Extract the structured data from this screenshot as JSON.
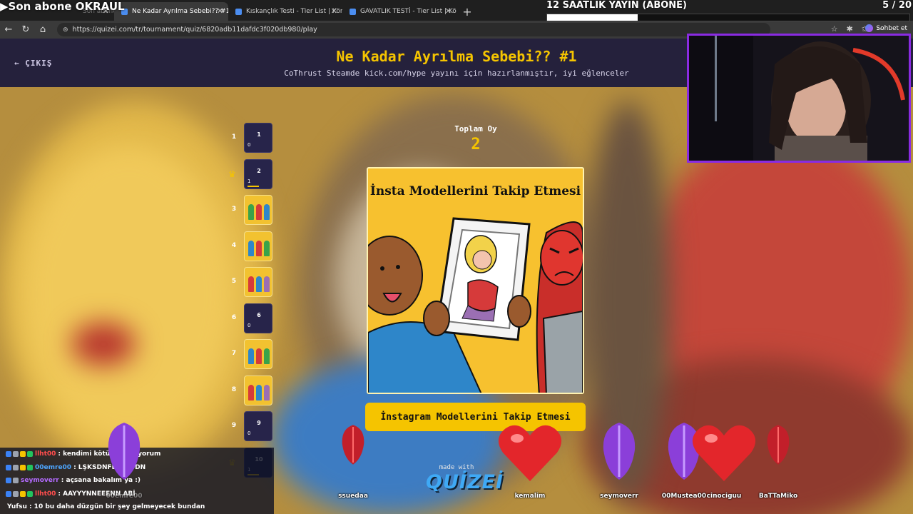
{
  "browser": {
    "tabs": [
      {
        "title": "Son abone OKRAUL",
        "active": false
      },
      {
        "title": "Ne Kadar Ayrılma Sebebi?? #1 - Ti",
        "active": true
      },
      {
        "title": "Kıskançlık Testi - Tier List | Kör Sır",
        "active": false
      },
      {
        "title": "GAVATLIK TESTİ - Tier List | Kör Sır",
        "active": false
      }
    ],
    "url": "https://quizei.com/tr/tournament/quiz/6820adb11dafdc3f020db980/play",
    "chat_button": "Sohbet et"
  },
  "stream": {
    "last_sub": "Son abone OKRAUL",
    "goal_title": "12 SAATLIK YAYIN (ABONE)",
    "goal_count": "5 / 20",
    "goal_progress": 0.25
  },
  "quiz": {
    "exit_label": "ÇIKIŞ",
    "title": "Ne Kadar Ayrılma Sebebi?? #1",
    "subtitle": "CoThrust Steamde kick.com/hype yayını için hazırlanmıştır, iyi eğlenceler",
    "total_label": "Toplam Oy",
    "total_value": "2",
    "card_title": "İnsta Modellerini Takip Etmesi",
    "answer_label": "İnstagram Modellerini Takip Etmesi",
    "made_with": "made with",
    "logo": "QUİZEİ",
    "ranks": [
      {
        "num": "1",
        "type": "empty",
        "card_num": "1",
        "votes": "0",
        "crown": false
      },
      {
        "num": "2",
        "type": "empty",
        "card_num": "2",
        "votes": "1",
        "crown": true
      },
      {
        "num": "3",
        "type": "image",
        "crown": false
      },
      {
        "num": "4",
        "type": "image",
        "crown": false
      },
      {
        "num": "5",
        "type": "image",
        "crown": false
      },
      {
        "num": "6",
        "type": "empty",
        "card_num": "6",
        "votes": "0",
        "crown": false
      },
      {
        "num": "7",
        "type": "image",
        "crown": false
      },
      {
        "num": "8",
        "type": "image",
        "crown": false
      },
      {
        "num": "9",
        "type": "empty",
        "card_num": "9",
        "votes": "0",
        "crown": false
      },
      {
        "num": "10",
        "type": "empty",
        "card_num": "10",
        "votes": "1",
        "crown": true
      }
    ]
  },
  "chat": [
    {
      "user": "llht00",
      "text": ": kendimi kötü hissediyorum",
      "color": "#ff4d4d"
    },
    {
      "user": "00emre00",
      "text": ": LŞKSDNFBŞKLSDN",
      "color": "#4da6ff"
    },
    {
      "user": "seymoverr",
      "text": ": açsana bakalım ya :)",
      "color": "#b36bff"
    },
    {
      "user": "llht00",
      "text": ": AAYYYNNEEENN ABİ",
      "color": "#ff4d4d"
    },
    {
      "user": "Yufsu",
      "text": ": 10 bu daha düzgün bir şey gelmeyecek bundan",
      "color": "#ffffff"
    }
  ],
  "alerts": [
    {
      "name": "00emre00",
      "gem": "purple"
    },
    {
      "name": "ssuedaa",
      "gem": "red-gem"
    },
    {
      "name": "kemalim",
      "gem": "heart"
    },
    {
      "name": "seymoverr",
      "gem": "purple"
    },
    {
      "name": "00Mustea00",
      "gem": "purple"
    },
    {
      "name": "cinociguu",
      "gem": "heart"
    },
    {
      "name": "BaTTaMiko",
      "gem": "red-gem"
    }
  ]
}
